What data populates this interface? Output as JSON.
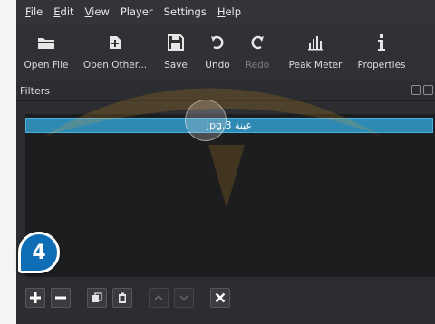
{
  "menubar": {
    "items": [
      {
        "mnemonic": "F",
        "rest": "ile"
      },
      {
        "mnemonic": "E",
        "rest": "dit"
      },
      {
        "mnemonic": "V",
        "rest": "iew"
      },
      {
        "mnemonic": "",
        "rest": "Player"
      },
      {
        "mnemonic": "",
        "rest": "Settings"
      },
      {
        "mnemonic": "H",
        "rest": "elp"
      }
    ]
  },
  "toolbar": {
    "open_file": "Open File",
    "open_other": "Open Other...",
    "save": "Save",
    "undo": "Undo",
    "redo": "Redo",
    "peak_meter": "Peak Meter",
    "properties": "Properties"
  },
  "filters_panel": {
    "title": "Filters",
    "items": [
      "عينة 3.jpg"
    ]
  },
  "step_badge": "4",
  "colors": {
    "app_bg": "#2b2d30",
    "selected_row": "#2e8ab3",
    "badge": "#0f6db5",
    "watermark": "#f0a020"
  },
  "icons": {
    "bottom_bar": [
      "plus-icon",
      "minus-icon",
      "copy-icon",
      "paste-icon",
      "move-up-icon",
      "move-down-icon",
      "close-icon"
    ]
  }
}
